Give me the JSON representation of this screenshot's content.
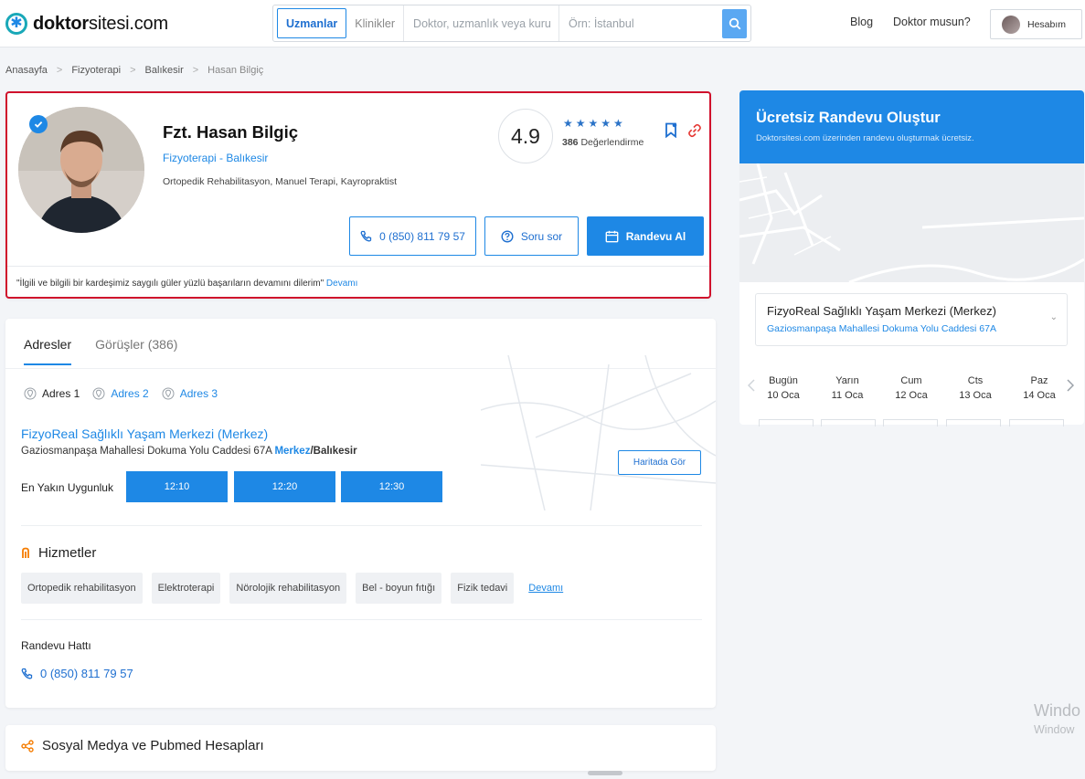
{
  "header": {
    "logo": "doktorsitesi.com",
    "logo_bold": "doktor",
    "logo_rest": "sitesi.com",
    "search_tabs": [
      "Uzmanlar",
      "Klinikler"
    ],
    "search_placeholder": "Doktor, uzmanlık veya kuru",
    "location_placeholder": "Örn: İstanbul",
    "nav": [
      "Blog",
      "Doktor musun?"
    ],
    "account": "Hesabım"
  },
  "breadcrumb": [
    "Anasayfa",
    "Fizyoterapi",
    "Balıkesir",
    "Hasan Bilgiç"
  ],
  "profile": {
    "name": "Fzt. Hasan Bilgiç",
    "specialty": "Fizyoterapi - Balıkesir",
    "subspecialties": "Ortopedik Rehabilitasyon, Manuel Terapi, Kayropraktist",
    "rating": "4.9",
    "stars": "★★★★★",
    "review_count": "386",
    "review_label": "Değerlendirme",
    "phone_button": "0 (850) 811 79 57",
    "ask_button": "Soru sor",
    "appointment_button": "Randevu Al",
    "quote": "\"İlgili ve bilgili bir kardeşimiz saygılı güler yüzlü başarıların devamını dilerim\"",
    "quote_more": "Devamı"
  },
  "tabs": [
    {
      "label": "Adresler",
      "active": true
    },
    {
      "label": "Görüşler (386)",
      "active": false
    }
  ],
  "addresses": {
    "tabs": [
      "Adres 1",
      "Adres 2",
      "Adres 3"
    ],
    "clinic_name": "FizyoReal Sağlıklı Yaşam Merkezi (Merkez)",
    "address": "Gaziosmanpaşa Mahallesi Dokuma Yolu Caddesi 67A",
    "district": "Merkez",
    "city": "/Balıkesir",
    "map_button": "Haritada Gör",
    "nearest_label": "En Yakın Uygunluk",
    "slots": [
      "12:10",
      "12:20",
      "12:30"
    ]
  },
  "services": {
    "title": "Hizmetler",
    "items": [
      "Ortopedik rehabilitasyon",
      "Elektroterapi",
      "Nörolojik rehabilitasyon",
      "Bel - boyun fıtığı",
      "Fizik tedavi"
    ],
    "more": "Devamı"
  },
  "appointment_line": {
    "title": "Randevu Hattı",
    "phone": "0 (850) 811 79 57"
  },
  "social": {
    "title": "Sosyal Medya ve Pubmed Hesapları"
  },
  "sidebar": {
    "title": "Ücretsiz Randevu Oluştur",
    "subtitle": "Doktorsitesi.com üzerinden randevu oluşturmak ücretsiz.",
    "clinic_name": "FizyoReal Sağlıklı Yaşam Merkezi (Merkez)",
    "clinic_address": "Gaziosmanpaşa Mahallesi Dokuma Yolu Caddesi 67A",
    "days": [
      {
        "name": "Bugün",
        "date": "10 Oca"
      },
      {
        "name": "Yarın",
        "date": "11 Oca"
      },
      {
        "name": "Cum",
        "date": "12 Oca"
      },
      {
        "name": "Cts",
        "date": "13 Oca"
      },
      {
        "name": "Paz",
        "date": "14 Oca"
      }
    ]
  },
  "watermark": {
    "line1": "Windo",
    "line2": "Window"
  },
  "colors": {
    "primary": "#1e88e5",
    "highlight_border": "#d0102c",
    "service_icon": "#f57c00"
  }
}
